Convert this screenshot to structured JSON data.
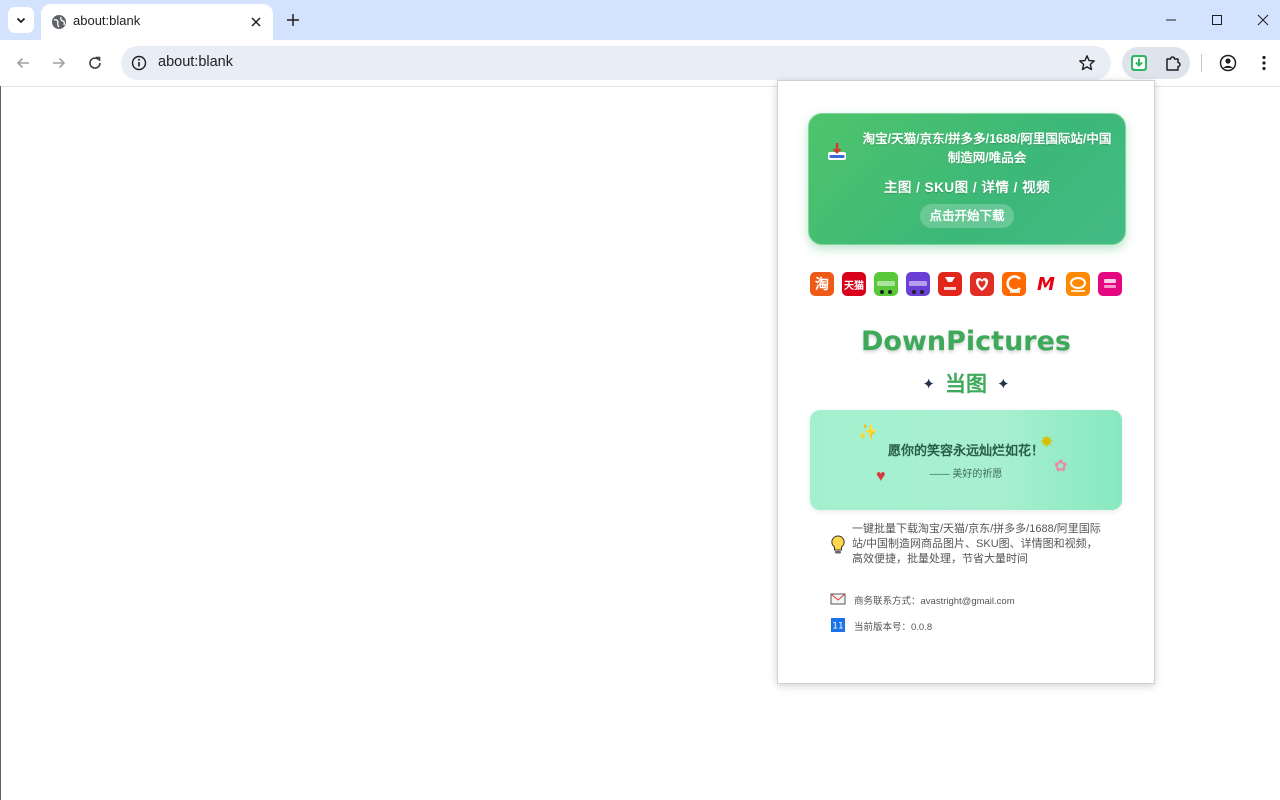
{
  "browser": {
    "tab": {
      "title": "about:blank"
    },
    "address_bar": {
      "url": "about:blank"
    },
    "icons": {
      "tab_search": "chevron-down-icon",
      "favicon": "globe-icon",
      "tab_close": "close-icon",
      "new_tab": "plus-icon",
      "back": "arrow-left-icon",
      "forward": "arrow-right-icon",
      "reload": "reload-icon",
      "site_info": "info-icon",
      "bookmark": "star-icon",
      "extension": "download-extension-icon",
      "extensions_menu": "puzzle-icon",
      "profile": "profile-icon",
      "menu": "kebab-menu-icon"
    }
  },
  "popup": {
    "hero": {
      "platforms_line": "淘宝/天猫/京东/拼多多/1688/阿里国际站/中国制造网/唯品会",
      "content_types": "主图 / SKU图 / 详情 / 视频",
      "start_button": "点击开始下载"
    },
    "platform_icons": [
      {
        "name": "taobao",
        "label": "淘",
        "color": "#ef5a16"
      },
      {
        "name": "tmall",
        "label": "天猫",
        "color": "#d9001b"
      },
      {
        "name": "tmall-supermarket",
        "label": "",
        "color": "#59c93a"
      },
      {
        "name": "tmall-global",
        "label": "",
        "color": "#6a3fd6"
      },
      {
        "name": "jd",
        "label": "",
        "color": "#e1251b"
      },
      {
        "name": "pinduoduo",
        "label": "",
        "color": "#e02e24"
      },
      {
        "name": "1688",
        "label": "",
        "color": "#ff6a00"
      },
      {
        "name": "made-in-china",
        "label": "M",
        "color": "#ffffff"
      },
      {
        "name": "alibaba",
        "label": "",
        "color": "#ff8a00"
      },
      {
        "name": "vip",
        "label": "",
        "color": "#e5077f"
      }
    ],
    "brand_name": "DownPictures",
    "brand_sub": "当图",
    "wish": {
      "title": "愿你的笑容永远灿烂如花！",
      "attribution": "—— 美好的祈愿"
    },
    "description": "一键批量下载淘宝/天猫/京东/拼多多/1688/阿里国际站/中国制造网商品图片、SKU图、详情图和视频，高效便捷，批量处理，节省大量时间",
    "contact": "商务联系方式：avastright@gmail.com",
    "version": "当前版本号：0.0.8",
    "colors": {
      "brand_green": "#3ea95a",
      "hero_green": "#4ec46c",
      "wish_mint": "#a3f0cf"
    }
  }
}
